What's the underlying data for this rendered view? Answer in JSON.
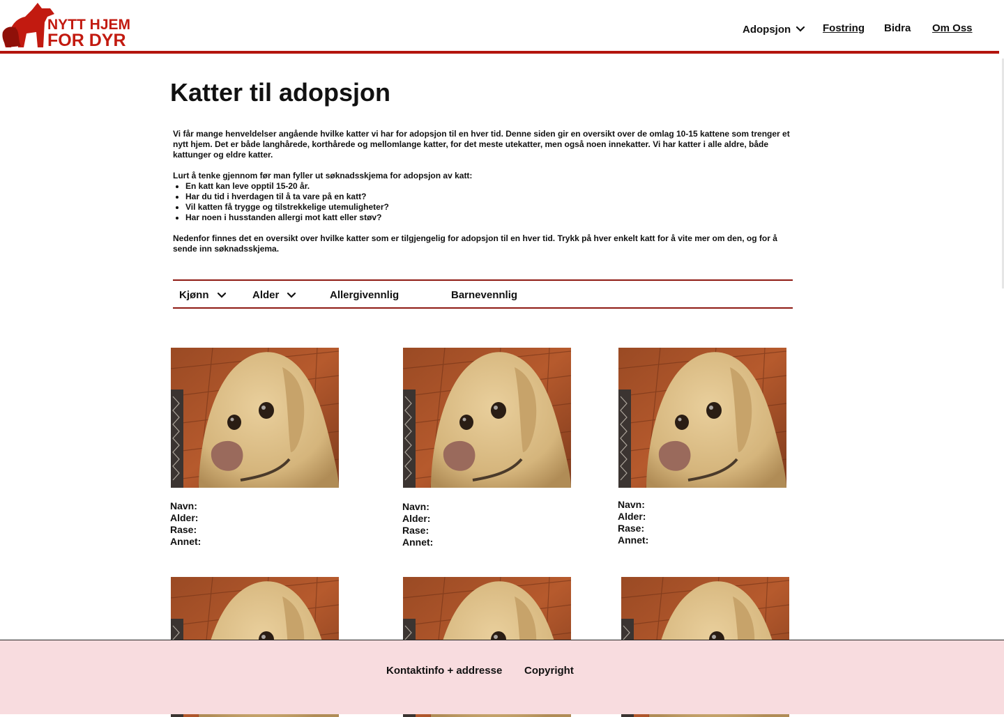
{
  "logo": {
    "line1": "NYTT HJEM",
    "line2": "FOR DYR",
    "brand_color": "#c21a10"
  },
  "nav": {
    "items": [
      {
        "label": "Adopsjon",
        "icon": "chevron-down-icon"
      },
      {
        "label": "Fostring"
      },
      {
        "label": "Bidra"
      },
      {
        "label": "Om Oss"
      }
    ]
  },
  "main": {
    "title": "Katter til adopsjon",
    "intro": "Vi får mange henveldelser angående hvilke katter vi har for adopsjon til en hver tid. Denne siden gir en oversikt over de omlag 10-15 kattene som trenger et nytt hjem. Det er både langhårede, korthårede og mellomlange katter, for det meste utekatter, men også noen innekatter.  Vi har katter i alle aldre, både kattunger og eldre katter.",
    "checklist_heading": "Lurt å tenke gjennom før man fyller ut søknadsskjema for adopsjon av katt:",
    "checklist": [
      "En katt kan leve opptil 15-20 år.",
      "Har du tid i hverdagen til å ta vare på en katt?",
      "Vil katten få trygge og tilstrekkelige utemuligheter?",
      "Har noen i husstanden allergi mot katt eller støv?"
    ],
    "outro": "Nedenfor finnes det en oversikt over hvilke katter som er tilgjengelig for adopsjon til en hver tid. Trykk på hver enkelt katt for å vite mer om den, og for å sende inn søknadsskjema."
  },
  "filters": {
    "items": [
      {
        "label": "Kjønn",
        "icon": "chevron-down-icon"
      },
      {
        "label": "Alder",
        "icon": "chevron-down-icon"
      },
      {
        "label": "Allergivennlig"
      },
      {
        "label": "Barnevennlig"
      }
    ],
    "line_color": "#8e1a13"
  },
  "card_fields": {
    "name": "Navn:",
    "age": "Alder:",
    "breed": "Rase:",
    "other": "Annet:"
  },
  "footer": {
    "contact": "Kontaktinfo + addresse",
    "copyright": "Copyright",
    "background": "#f8dcdf"
  }
}
